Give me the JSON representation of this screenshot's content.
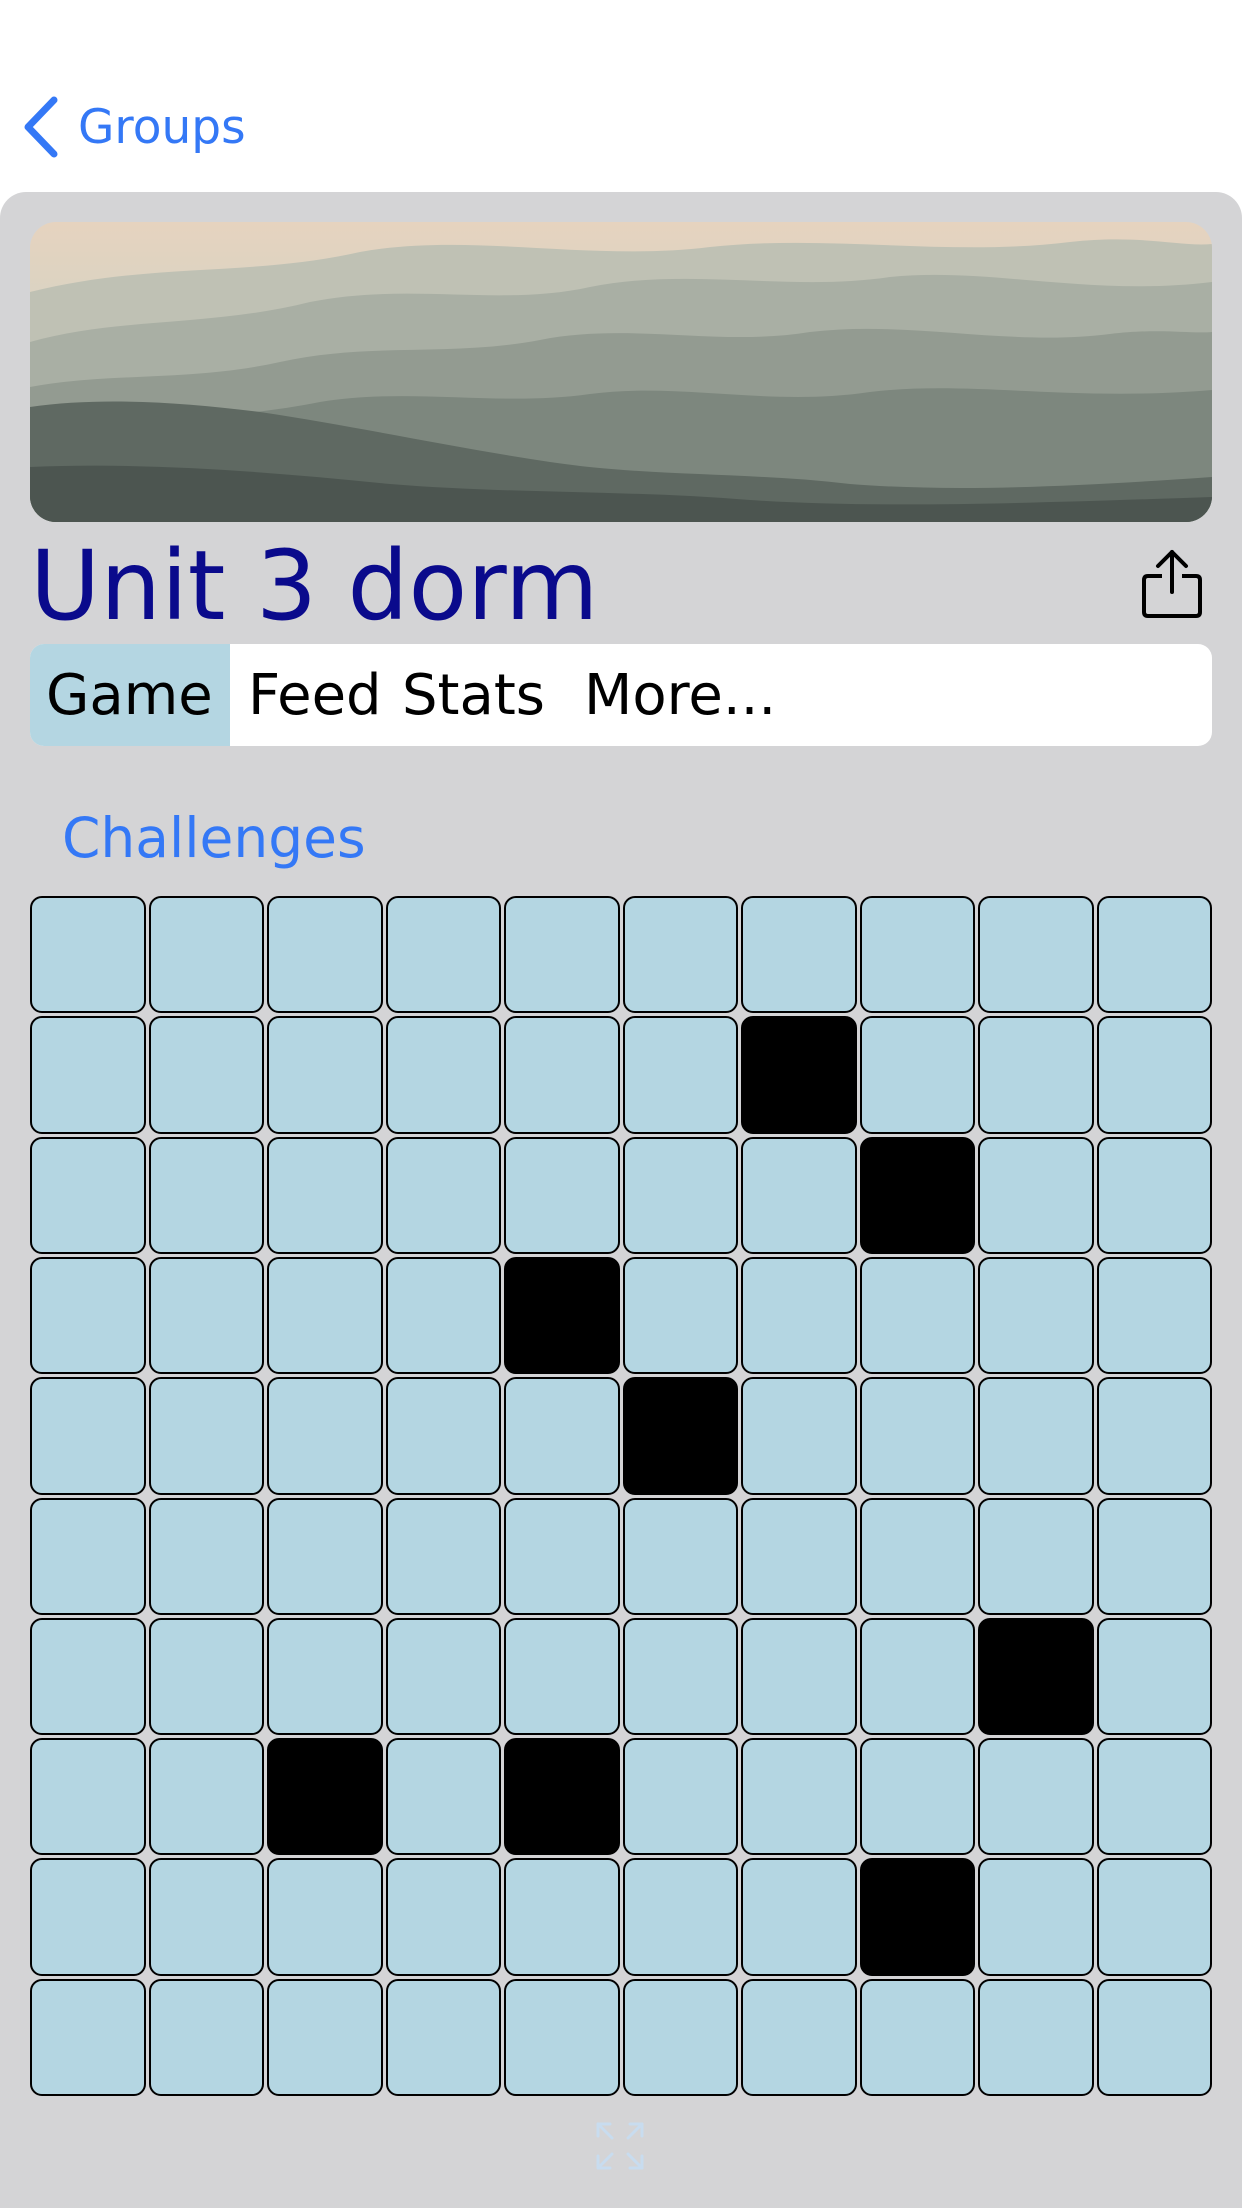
{
  "nav": {
    "back_label": "Groups",
    "back_icon": "chevron-left-icon"
  },
  "banner": {
    "image": "misty-mountain-ridges-landscape"
  },
  "group": {
    "title": "Unit 3 dorm",
    "share_icon": "share-icon"
  },
  "tabs": [
    {
      "label": "Game",
      "active": true
    },
    {
      "label": "Feed",
      "active": false
    },
    {
      "label": "Stats",
      "active": false
    },
    {
      "label": "More...",
      "active": false
    }
  ],
  "challenges_label": "Challenges",
  "board": {
    "rows": 10,
    "cols": 10,
    "filled_cells": [
      [
        1,
        6
      ],
      [
        2,
        7
      ],
      [
        3,
        4
      ],
      [
        4,
        5
      ],
      [
        6,
        8
      ],
      [
        7,
        2
      ],
      [
        7,
        4
      ],
      [
        8,
        7
      ]
    ]
  },
  "colors": {
    "accent": "#3478f6",
    "title": "#0a0a8c",
    "panel": "#d4d4d6",
    "cell_empty": "#b4d6e2",
    "cell_filled": "#000000",
    "tab_active": "#b4d6e2"
  },
  "expand_icon": "expand-arrows-icon"
}
